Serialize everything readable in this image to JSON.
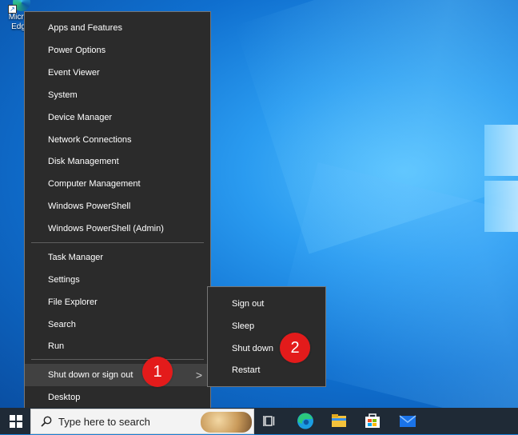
{
  "desktop": {
    "icon_label": "Microsoft Edge",
    "icon_label_visible": "Micro Edg"
  },
  "menu": {
    "items": [
      {
        "label": "Apps and Features"
      },
      {
        "label": "Power Options"
      },
      {
        "label": "Event Viewer"
      },
      {
        "label": "System"
      },
      {
        "label": "Device Manager"
      },
      {
        "label": "Network Connections"
      },
      {
        "label": "Disk Management"
      },
      {
        "label": "Computer Management"
      },
      {
        "label": "Windows PowerShell"
      },
      {
        "label": "Windows PowerShell (Admin)"
      },
      {
        "label": "Task Manager"
      },
      {
        "label": "Settings"
      },
      {
        "label": "File Explorer"
      },
      {
        "label": "Search"
      },
      {
        "label": "Run"
      },
      {
        "label": "Shut down or sign out"
      },
      {
        "label": "Desktop"
      }
    ],
    "submenu_chevron": ">"
  },
  "submenu": {
    "items": [
      {
        "label": "Sign out"
      },
      {
        "label": "Sleep"
      },
      {
        "label": "Shut down"
      },
      {
        "label": "Restart"
      }
    ]
  },
  "badges": {
    "one": "1",
    "two": "2",
    "color": "#e31b1b"
  },
  "taskbar": {
    "search_placeholder": "Type here to search",
    "icons": [
      "task-view-icon",
      "edge-icon",
      "file-explorer-icon",
      "microsoft-store-icon",
      "mail-icon"
    ]
  }
}
